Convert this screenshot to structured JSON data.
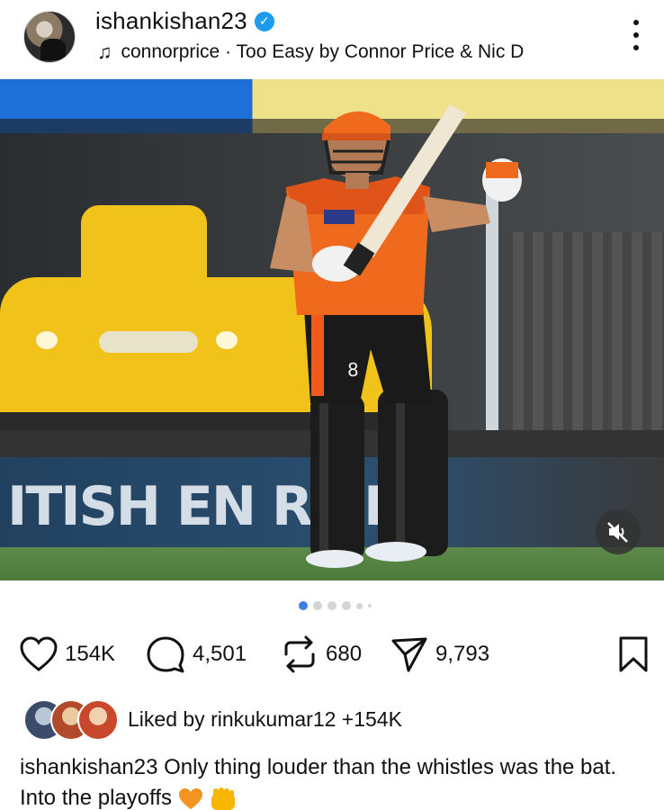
{
  "header": {
    "username": "ishankishan23",
    "audio": {
      "artist_handle": "connorprice",
      "separator": "·",
      "track": "Too Easy by Connor Price & Nic D"
    }
  },
  "media": {
    "board_text": "ITISH EN  RE  B",
    "carousel": {
      "count": 6,
      "active_index": 0
    }
  },
  "actions": {
    "likes": "154K",
    "comments": "4,501",
    "reposts": "680",
    "shares": "9,793"
  },
  "liked_by": {
    "prefix": "Liked by",
    "user": "rinkukumar12",
    "suffix": "+154K"
  },
  "caption": {
    "username": "ishankishan23",
    "text": "Only thing louder than the whistles was the bat. Into the playoffs"
  },
  "colors": {
    "verified": "#1d9bf0",
    "active_dot": "#3f7de8",
    "heart_emoji": "#f2941f",
    "fist_emoji": "#f7b500"
  }
}
